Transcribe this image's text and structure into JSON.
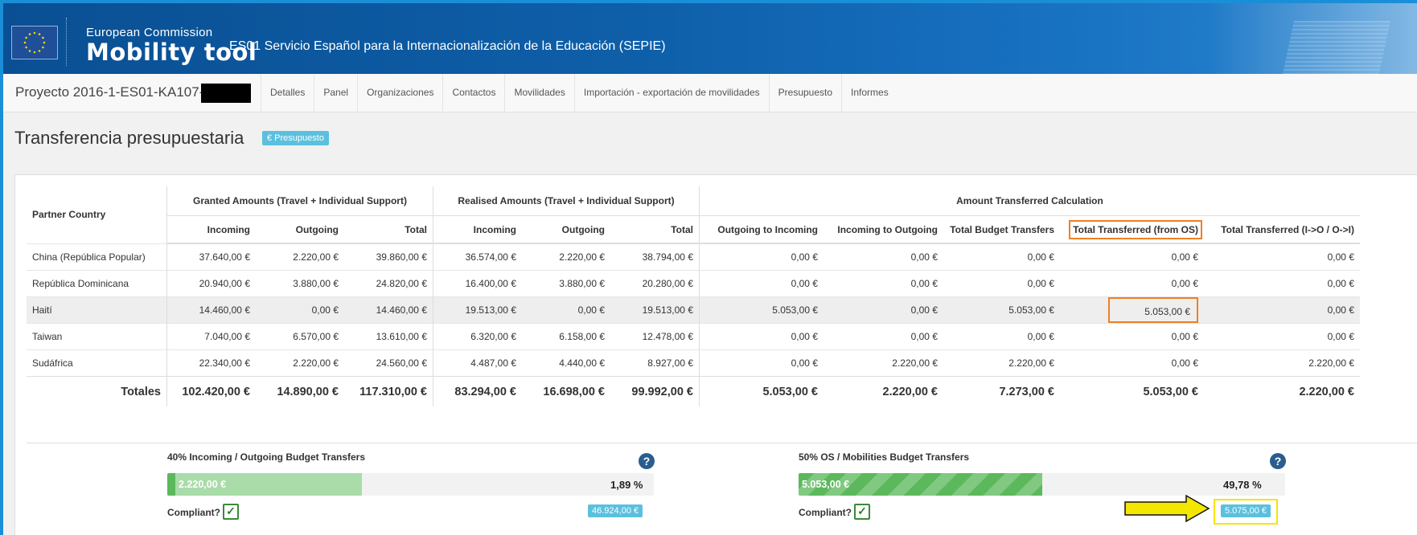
{
  "header": {
    "org_line": "European Commission",
    "app_name": "Mobility tool",
    "agency": "ES01 Servicio Español para la Internacionalización de la Educación (SEPIE)"
  },
  "nav": {
    "project": "Proyecto 2016-1-ES01-KA107-",
    "items": [
      "Detalles",
      "Panel",
      "Organizaciones",
      "Contactos",
      "Movilidades",
      "Importación - exportación de movilidades",
      "Presupuesto",
      "Informes"
    ]
  },
  "page": {
    "title": "Transferencia presupuestaria",
    "badge": "€ Presupuesto"
  },
  "table": {
    "group_headers": {
      "partner": "Partner Country",
      "granted": "Granted Amounts (Travel + Individual Support)",
      "realised": "Realised Amounts (Travel + Individual Support)",
      "transfer": "Amount Transferred Calculation"
    },
    "sub_headers": [
      "Incoming",
      "Outgoing",
      "Total",
      "Incoming",
      "Outgoing",
      "Total",
      "Outgoing to Incoming",
      "Incoming to Outgoing",
      "Total Budget Transfers",
      "Total Transferred (from OS)",
      "Total Transferred (I->O / O->I)"
    ],
    "rows": [
      [
        "China (República Popular)",
        "37.640,00 €",
        "2.220,00 €",
        "39.860,00 €",
        "36.574,00 €",
        "2.220,00 €",
        "38.794,00 €",
        "0,00 €",
        "0,00 €",
        "0,00 €",
        "0,00 €",
        "0,00 €"
      ],
      [
        "República Dominicana",
        "20.940,00 €",
        "3.880,00 €",
        "24.820,00 €",
        "16.400,00 €",
        "3.880,00 €",
        "20.280,00 €",
        "0,00 €",
        "0,00 €",
        "0,00 €",
        "0,00 €",
        "0,00 €"
      ],
      [
        "Haití",
        "14.460,00 €",
        "0,00 €",
        "14.460,00 €",
        "19.513,00 €",
        "0,00 €",
        "19.513,00 €",
        "5.053,00 €",
        "0,00 €",
        "5.053,00 €",
        "5.053,00 €",
        "0,00 €"
      ],
      [
        "Taiwan",
        "7.040,00 €",
        "6.570,00 €",
        "13.610,00 €",
        "6.320,00 €",
        "6.158,00 €",
        "12.478,00 €",
        "0,00 €",
        "0,00 €",
        "0,00 €",
        "0,00 €",
        "0,00 €"
      ],
      [
        "Sudáfrica",
        "22.340,00 €",
        "2.220,00 €",
        "24.560,00 €",
        "4.487,00 €",
        "4.440,00 €",
        "8.927,00 €",
        "0,00 €",
        "2.220,00 €",
        "2.220,00 €",
        "0,00 €",
        "2.220,00 €"
      ]
    ],
    "totals": [
      "Totales",
      "102.420,00 €",
      "14.890,00 €",
      "117.310,00 €",
      "83.294,00 €",
      "16.698,00 €",
      "99.992,00 €",
      "5.053,00 €",
      "2.220,00 €",
      "7.273,00 €",
      "5.053,00 €",
      "2.220,00 €"
    ]
  },
  "progress": {
    "left": {
      "title": "40% Incoming / Outgoing Budget Transfers",
      "bar_label": "2.220,00 €",
      "fraction": 0.4,
      "percent": "1,89 %",
      "compliant": "Compliant?",
      "limit": "46.924,00 €"
    },
    "right": {
      "title": "50% OS / Mobilities Budget Transfers",
      "bar_label": "5.053,00 €",
      "fraction": 0.5,
      "percent": "49,78 %",
      "compliant": "Compliant?",
      "limit": "5.075,00 €"
    }
  },
  "colors": {
    "header_blue": "#0e5fa9",
    "badge_cyan": "#5bc0de",
    "success_green": "#5cb85c",
    "highlight_orange": "#f07f22",
    "arrow_yellow": "#f5e600"
  },
  "icons": {
    "help": "question-circle-icon",
    "check": "check-square-icon",
    "flag": "eu-flag-icon"
  }
}
